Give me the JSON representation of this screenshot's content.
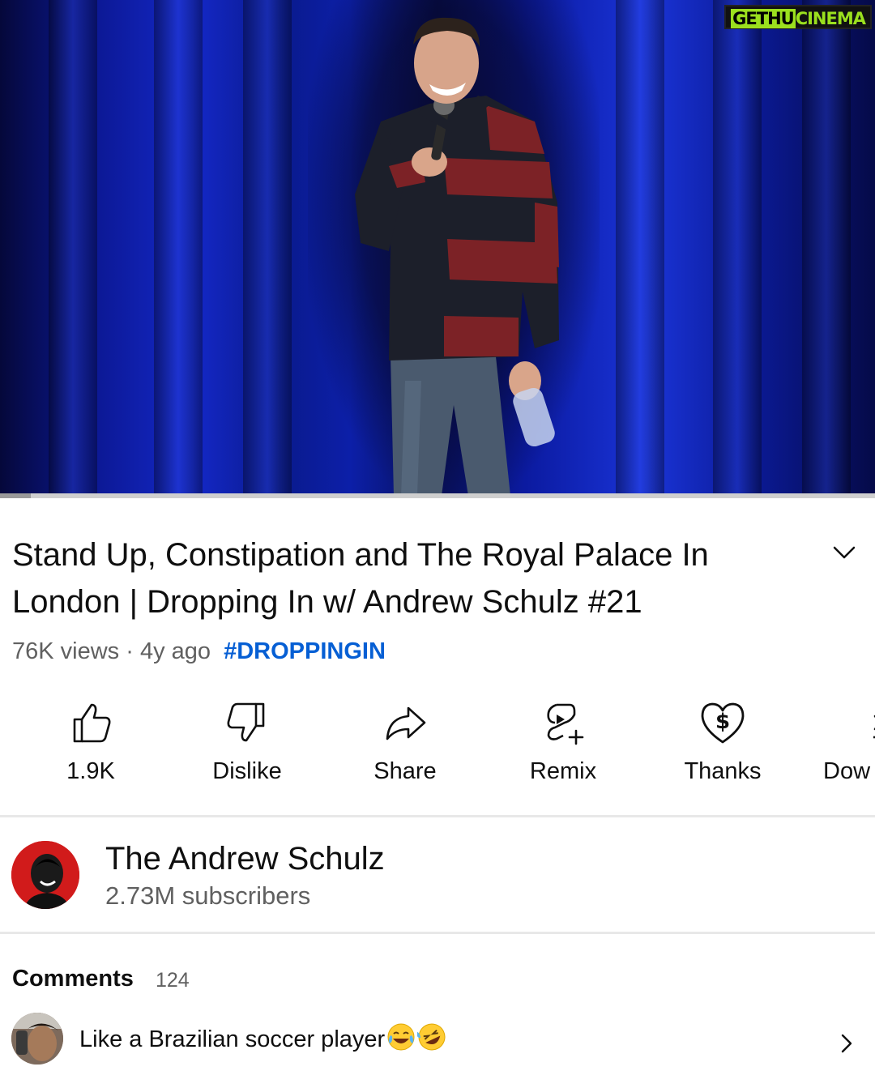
{
  "player": {
    "watermark": {
      "part1": "GETHU",
      "part2": "CINEMA"
    },
    "progress_fraction": 0.035
  },
  "video": {
    "title": "Stand Up, Constipation and The Royal Palace In London | Dropping In w/ Andrew Schulz #21",
    "views": "76K views",
    "separator": "·",
    "age": "4y ago",
    "hashtag": "#DROPPINGIN"
  },
  "actions": {
    "like_label": "1.9K",
    "dislike_label": "Dislike",
    "share_label": "Share",
    "remix_label": "Remix",
    "thanks_label": "Thanks",
    "download_label": "Dow"
  },
  "channel": {
    "name": "The Andrew Schulz",
    "subscribers": "2.73M subscribers"
  },
  "comments": {
    "heading": "Comments",
    "count": "124",
    "top_comment": "Like a Brazilian soccer player"
  },
  "colors": {
    "text_primary": "#0f0f0f",
    "text_secondary": "#606060",
    "hashtag": "#065fd4",
    "stage_blue": "#1428c8",
    "avatar_red": "#d11b1b",
    "watermark_green": "#9be01e"
  },
  "icons": [
    "thumbs-up-icon",
    "thumbs-down-icon",
    "share-arrow-icon",
    "remix-icon",
    "thanks-heart-dollar-icon",
    "download-icon",
    "chevron-down-icon",
    "chevron-right-icon"
  ]
}
